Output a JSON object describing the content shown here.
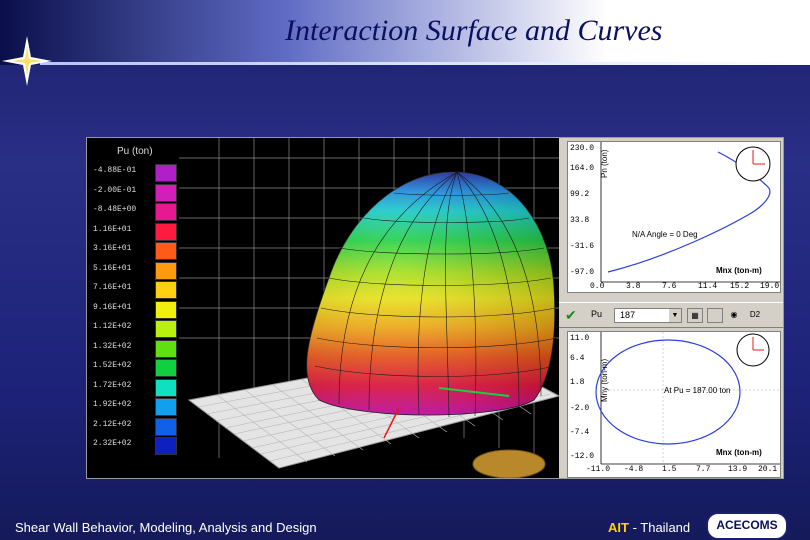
{
  "slide": {
    "title": "Interaction Surface and Curves",
    "footer_left": "Shear Wall Behavior, Modeling, Analysis and Design",
    "footer_ait": "AIT",
    "footer_place": " - Thailand",
    "footer_badge": "ACECOMS"
  },
  "legend": {
    "title": "Pu (ton)",
    "rows": [
      {
        "label": "-4.88E-01",
        "color": "#b020c8"
      },
      {
        "label": "-2.00E-01",
        "color": "#d020b8"
      },
      {
        "label": "-8.48E+00",
        "color": "#e81890"
      },
      {
        "label": "1.16E+01",
        "color": "#ff1a40"
      },
      {
        "label": "3.16E+01",
        "color": "#ff5a1a"
      },
      {
        "label": "5.16E+01",
        "color": "#ff9a10"
      },
      {
        "label": "7.16E+01",
        "color": "#ffd010"
      },
      {
        "label": "9.16E+01",
        "color": "#f0f010"
      },
      {
        "label": "1.12E+02",
        "color": "#b8f010"
      },
      {
        "label": "1.32E+02",
        "color": "#60e010"
      },
      {
        "label": "1.52E+02",
        "color": "#10d040"
      },
      {
        "label": "1.72E+02",
        "color": "#10e0c0"
      },
      {
        "label": "1.92E+02",
        "color": "#10a0f0"
      },
      {
        "label": "2.12E+02",
        "color": "#1060e8"
      },
      {
        "label": "2.32E+02",
        "color": "#1020c0"
      }
    ]
  },
  "top_graph": {
    "y_axis_title": "Pn (ton)",
    "y_ticks": [
      "230.0",
      "164.0",
      "99.2",
      "33.8",
      "-31.6",
      "-97.0"
    ],
    "x_ticks": [
      "0.0",
      "3.8",
      "7.6",
      "11.4",
      "15.2",
      "19.0"
    ],
    "x_axis_title": "Mnx (ton-m)",
    "annotation": "N/A Angle = 0 Deg"
  },
  "toolbar": {
    "label": "Pu",
    "combo_value": "187",
    "icon_d2": "D2"
  },
  "bottom_graph": {
    "y_axis_title": "Mny (ton-m)",
    "y_ticks": [
      "11.0",
      "6.4",
      "1.8",
      "-2.0",
      "-7.4",
      "-12.0"
    ],
    "x_ticks": [
      "-11.0",
      "-4.8",
      "1.5",
      "7.7",
      "13.9",
      "20.1"
    ],
    "x_axis_title": "Mnx (ton-m)",
    "annotation": "At Pu = 187.00 ton"
  },
  "icons": {
    "star": "four-point-star-icon",
    "check": "green-check-icon",
    "compass": "orientation-dial-icon"
  }
}
